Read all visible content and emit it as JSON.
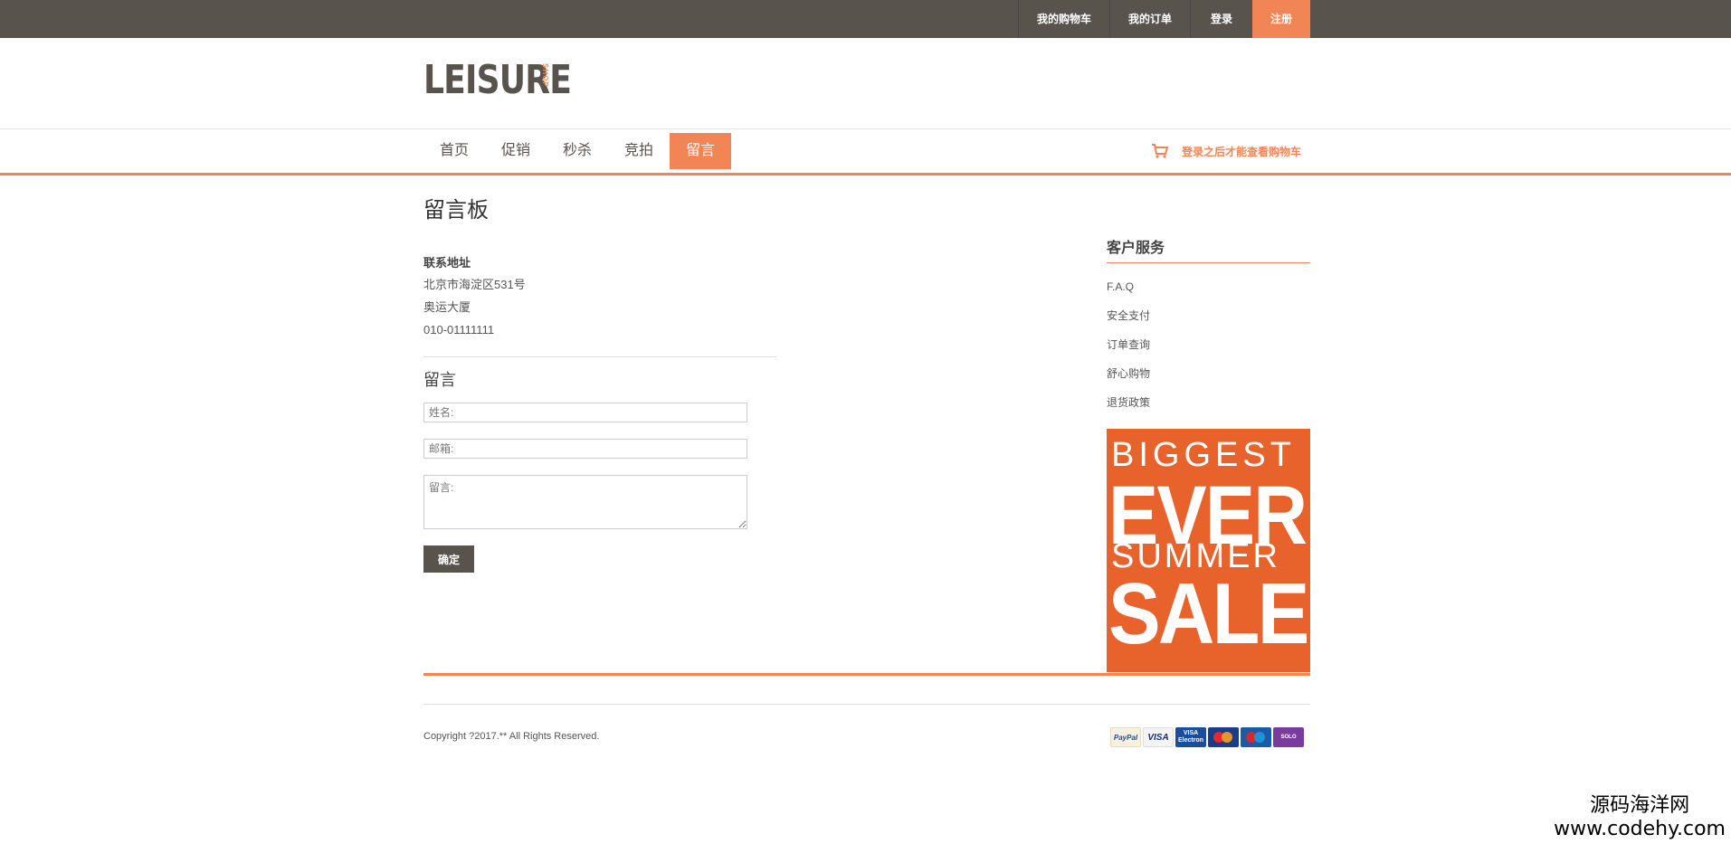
{
  "topbar": {
    "cart": "我的购物车",
    "orders": "我的订单",
    "login": "登录",
    "register": "注册"
  },
  "logo": {
    "text": "LEISURE",
    "sub": "SHOP"
  },
  "nav": {
    "items": [
      "首页",
      "促销",
      "秒杀",
      "竞拍",
      "留言"
    ],
    "active_index": 4,
    "cart_note": "登录之后才能查看购物车"
  },
  "page": {
    "title": "留言板"
  },
  "contact": {
    "label": "联系地址",
    "address1": "北京市海淀区531号",
    "address2": "奥运大厦",
    "phone": "010-01111111"
  },
  "message_form": {
    "title": "留言",
    "name_placeholder": "姓名:",
    "email_placeholder": "邮箱:",
    "message_placeholder": "留言:",
    "submit": "确定"
  },
  "sidebar": {
    "title": "客户服务",
    "items": [
      "F.A.Q",
      "安全支付",
      "订单查询",
      "舒心购物",
      "退货政策"
    ]
  },
  "promo": {
    "line1": "BIGGEST",
    "line2": "EVER",
    "line3": "SUMMER",
    "line4": "SALE"
  },
  "footer": {
    "copyright": "Copyright ?2017.** All Rights Reserved.",
    "payments": [
      "PayPal",
      "VISA",
      "VISA Electron",
      "MasterCard",
      "Maestro",
      "SOLO"
    ]
  },
  "watermark": {
    "line1": "源码海洋网",
    "line2": "www.codehy.com"
  },
  "colors": {
    "accent": "#f28555",
    "dark": "#59534e",
    "promo_bg": "#e8622b"
  }
}
